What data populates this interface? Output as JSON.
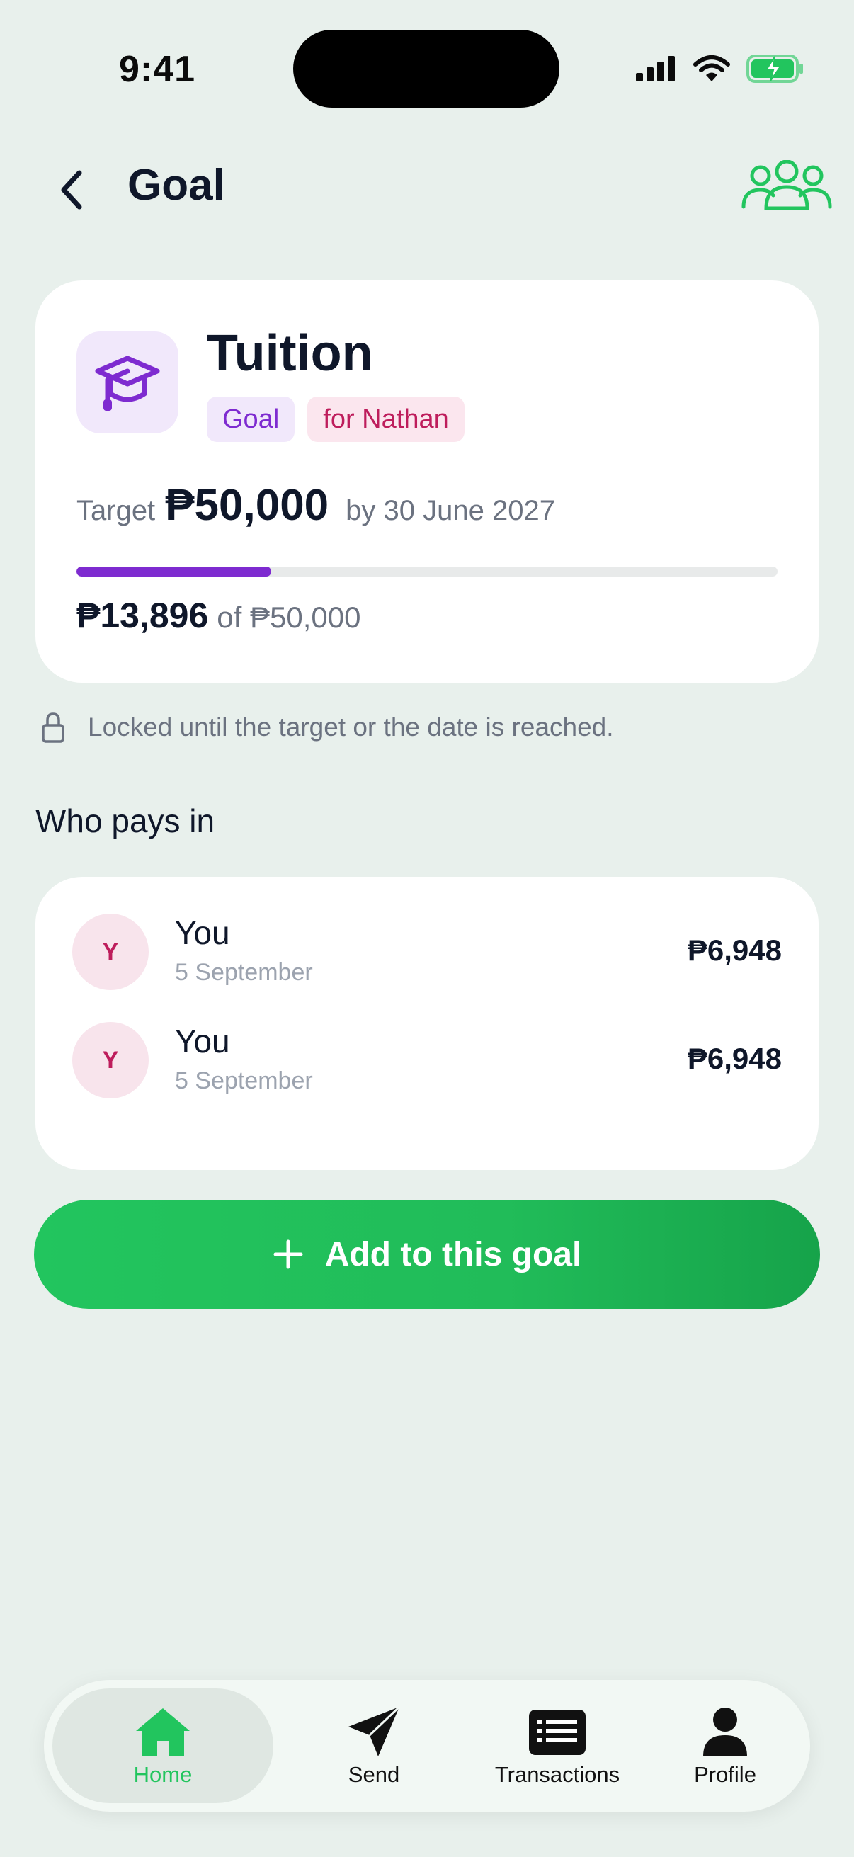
{
  "status_bar": {
    "time": "9:41"
  },
  "header": {
    "title": "Goal",
    "back_icon": "chevron-left-icon",
    "members_icon": "people-group-icon"
  },
  "goal": {
    "icon": "graduation-cap-icon",
    "name": "Tuition",
    "tags": [
      "Goal",
      "for Nathan"
    ],
    "target_label": "Target",
    "target_amount": "₱50,000",
    "target_date": "by 30 June 2027",
    "progress_fraction": 0.278,
    "saved_amount": "₱13,896",
    "saved_of": "of ₱50,000"
  },
  "lock_notice": "Locked until the target or the date is reached.",
  "who_pays": {
    "title": "Who pays in",
    "payers": [
      {
        "initial": "Y",
        "name": "You",
        "date": "5 September",
        "amount": "₱6,948"
      },
      {
        "initial": "Y",
        "name": "You",
        "date": "5 September",
        "amount": "₱6,948"
      }
    ]
  },
  "cta": {
    "label": "Add to this goal",
    "icon": "plus-icon"
  },
  "tabs": [
    {
      "label": "Home",
      "icon": "home-icon",
      "active": true
    },
    {
      "label": "Send",
      "icon": "send-icon",
      "active": false
    },
    {
      "label": "Transactions",
      "icon": "transactions-list-icon",
      "active": false
    },
    {
      "label": "Profile",
      "icon": "profile-icon",
      "active": false
    }
  ],
  "colors": {
    "background": "#e8f0ec",
    "accent_green": "#22c55e",
    "goal_purple": "#7e2bd0",
    "for_pink": "#be1d5c"
  }
}
